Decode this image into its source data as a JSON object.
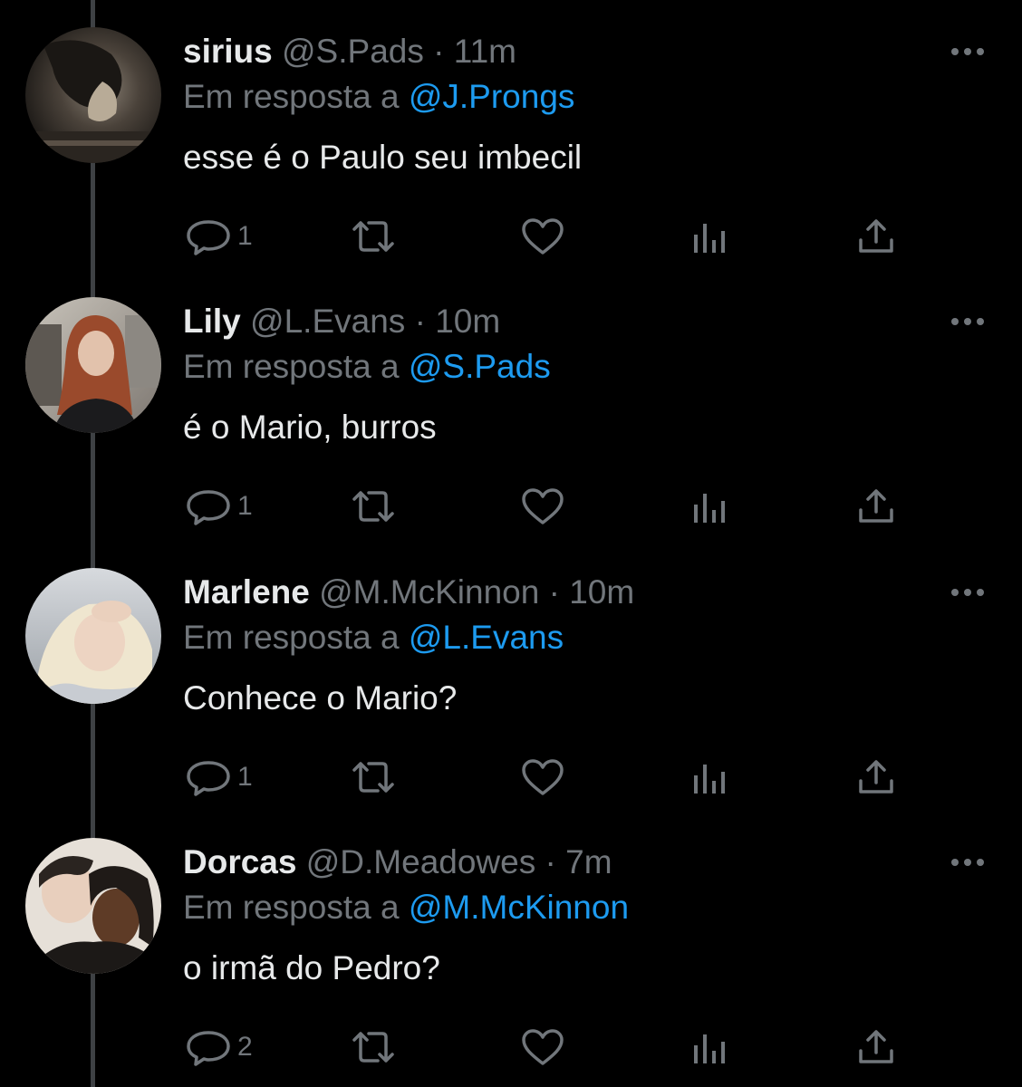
{
  "colors": {
    "background": "#000000",
    "text": "#e7e9ea",
    "muted": "#71767b",
    "link": "#1d9bf0",
    "thread_line": "#3e4144"
  },
  "reply_prefix": "Em resposta a",
  "separator": "·",
  "tweets": [
    {
      "name": "sirius",
      "handle": "@S.Pads",
      "time": "11m",
      "reply_to": "@J.Prongs",
      "text": "esse é o Paulo seu imbecil",
      "replies": "1",
      "avatar_icon": "avatar-photo"
    },
    {
      "name": "Lily",
      "handle": "@L.Evans",
      "time": "10m",
      "reply_to": "@S.Pads",
      "text": "é o Mario, burros",
      "replies": "1",
      "avatar_icon": "avatar-photo"
    },
    {
      "name": "Marlene",
      "handle": "@M.McKinnon",
      "time": "10m",
      "reply_to": "@L.Evans",
      "text": "Conhece o Mario?",
      "replies": "1",
      "avatar_icon": "avatar-photo"
    },
    {
      "name": "Dorcas",
      "handle": "@D.Meadowes",
      "time": "7m",
      "reply_to": "@M.McKinnon",
      "text": "o irmã do Pedro?",
      "replies": "2",
      "avatar_icon": "avatar-photo"
    }
  ],
  "action_icons": [
    "reply-icon",
    "retweet-icon",
    "like-icon",
    "views-icon",
    "share-icon"
  ],
  "more_icon": "more-options-icon"
}
